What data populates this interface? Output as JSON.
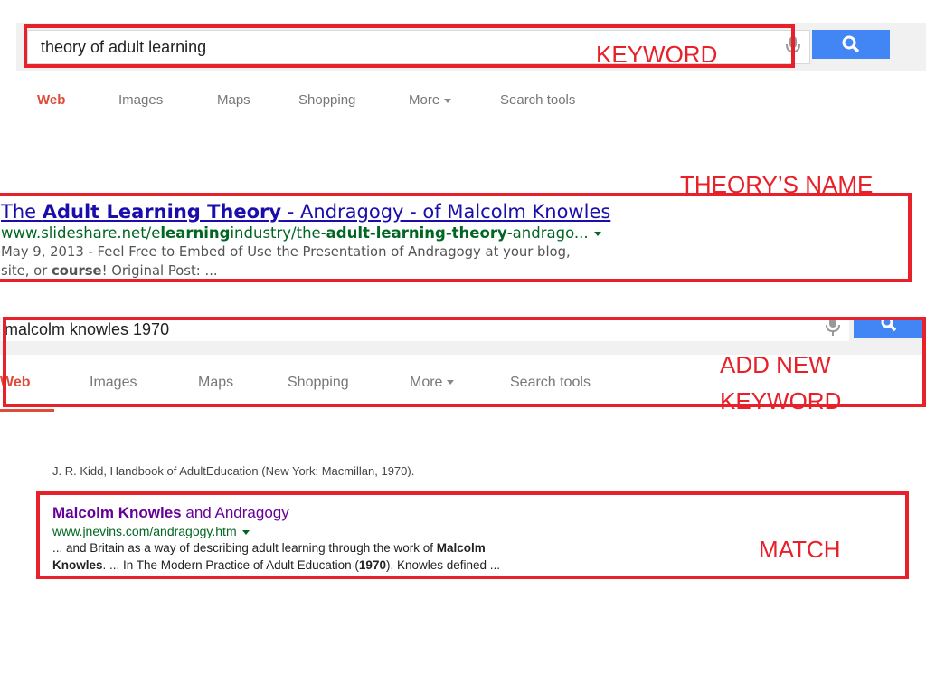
{
  "search1": {
    "query": "theory of adult learning",
    "tabs": [
      "Web",
      "Images",
      "Maps",
      "Shopping",
      "More",
      "Search tools"
    ]
  },
  "result1": {
    "title_pre": "The ",
    "title_bold": "Adult Learning Theory",
    "title_post": " - Andragogy - of Malcolm Knowles",
    "url_pre": "www.slideshare.net/e",
    "url_bold1": "learning",
    "url_mid": "industry/the-",
    "url_bold2": "adult-learning-theory",
    "url_post": "-andrago...",
    "snip1": "May 9, 2013 - Feel Free to Embed of Use the Presentation of Andragogy at your blog,",
    "snip2_pre": "site, or ",
    "snip2_bold": "course",
    "snip2_post": "! Original Post: ..."
  },
  "search2": {
    "query": "malcolm knowles 1970",
    "tabs": [
      "Web",
      "Images",
      "Maps",
      "Shopping",
      "More",
      "Search tools"
    ]
  },
  "cutoff_line": "J. R. Kidd, Handbook of AdultEducation (New York: Macmillan, 1970).",
  "result2": {
    "title_bold": "Malcolm Knowles",
    "title_post": " and Andragogy",
    "url": "www.jnevins.com/andragogy.htm",
    "snip1_pre": "... and Britain as a way of describing adult learning through the work of ",
    "snip1_bold": "Malcolm",
    "snip2_bold1": "Knowles",
    "snip2_mid": ". ... In The Modern Practice of Adult Education (",
    "snip2_bold2": "1970",
    "snip2_post": "), Knowles defined  ..."
  },
  "annotations": {
    "keyword": "KEYWORD",
    "theory_name": "THEORY’S NAME",
    "add_new_1": "ADD NEW",
    "add_new_2": "KEYWORD",
    "match": "MATCH"
  },
  "icons": {
    "mic": "microphone-icon",
    "search": "magnifier-icon",
    "dropdown": "caret-down-icon"
  },
  "colors": {
    "annotation_red": "#e8202a",
    "google_blue": "#4285f4",
    "link_blue": "#1a0dab",
    "visited_purple": "#660099",
    "url_green": "#006621",
    "active_tab": "#dd4b39"
  }
}
